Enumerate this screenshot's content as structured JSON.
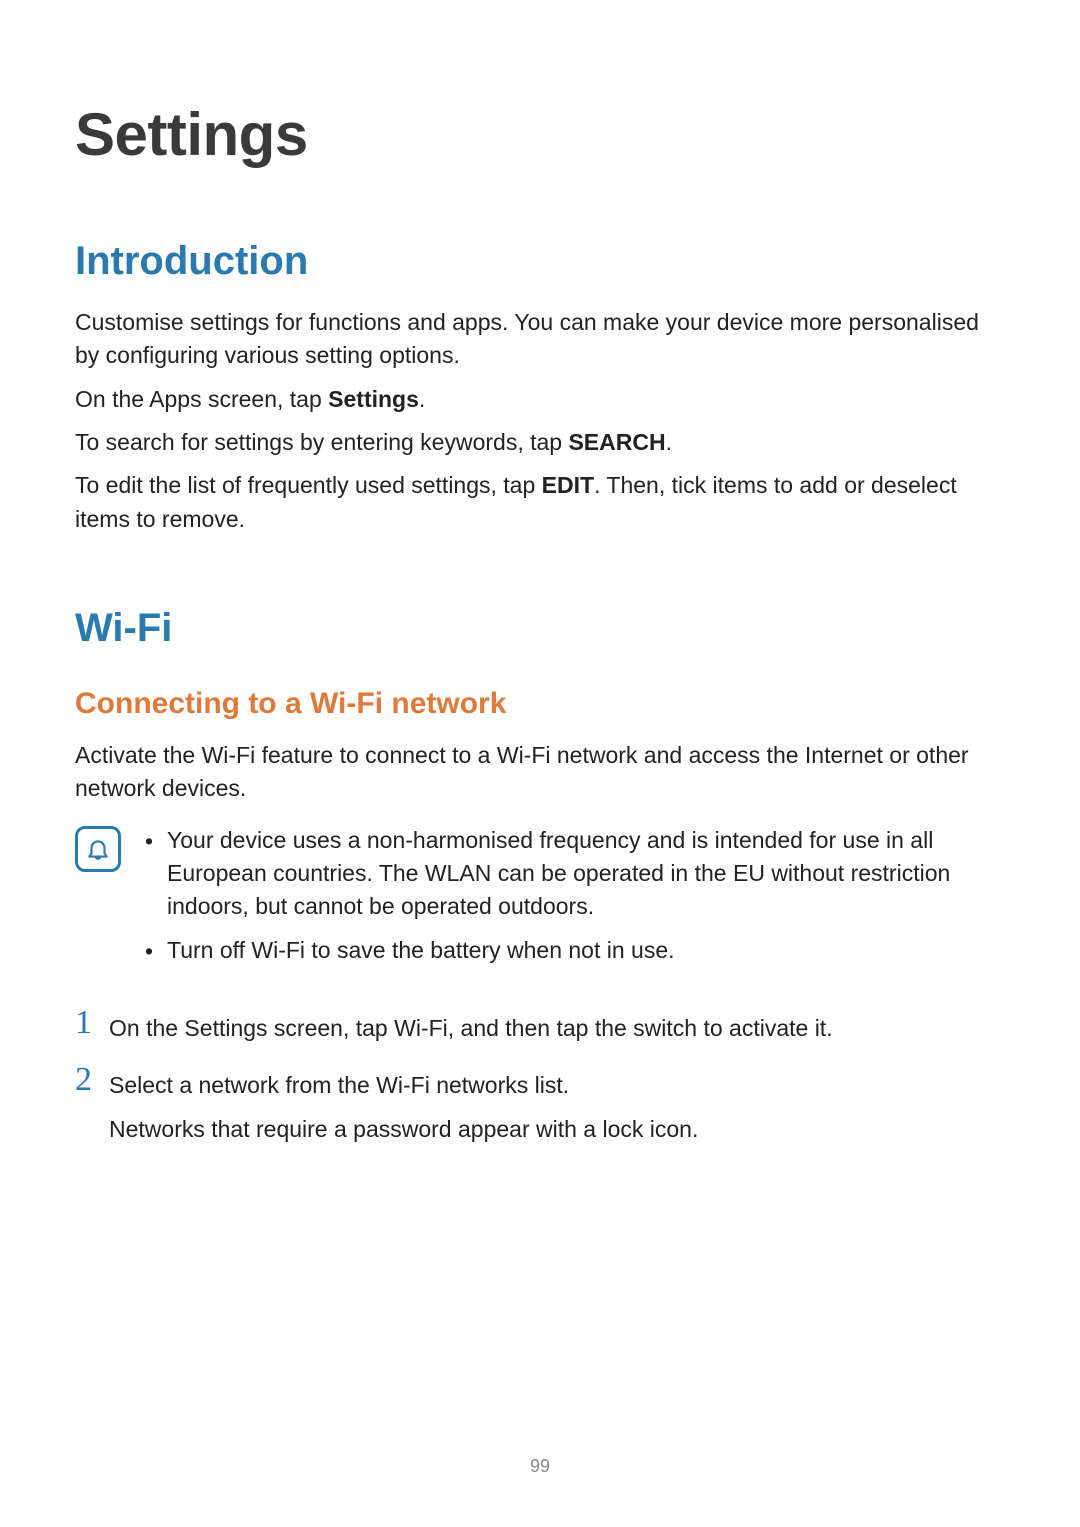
{
  "title": "Settings",
  "sections": {
    "intro": {
      "heading": "Introduction",
      "p1_a": "Customise settings for functions and apps. You can make your device more personalised by configuring various setting options.",
      "p2_a": "On the Apps screen, tap ",
      "p2_bold": "Settings",
      "p2_b": ".",
      "p3_a": "To search for settings by entering keywords, tap ",
      "p3_bold": "SEARCH",
      "p3_b": ".",
      "p4_a": "To edit the list of frequently used settings, tap ",
      "p4_bold": "EDIT",
      "p4_b": ". Then, tick items to add or deselect items to remove."
    },
    "wifi": {
      "heading": "Wi-Fi",
      "sub_heading": "Connecting to a Wi-Fi network",
      "p1": "Activate the Wi-Fi feature to connect to a Wi-Fi network and access the Internet or other network devices.",
      "notes": {
        "b1": "Your device uses a non-harmonised frequency and is intended for use in all European countries. The WLAN can be operated in the EU without restriction indoors, but cannot be operated outdoors.",
        "b2": "Turn off Wi-Fi to save the battery when not in use."
      },
      "steps": {
        "s1_a": "On the Settings screen, tap ",
        "s1_bold": "Wi-Fi",
        "s1_b": ", and then tap the switch to activate it.",
        "s2_a": "Select a network from the Wi-Fi networks list.",
        "s2_sub": "Networks that require a password appear with a lock icon."
      }
    }
  },
  "page_number": "99",
  "glyphs": {
    "bullet": "•",
    "step1": "1",
    "step2": "2"
  }
}
